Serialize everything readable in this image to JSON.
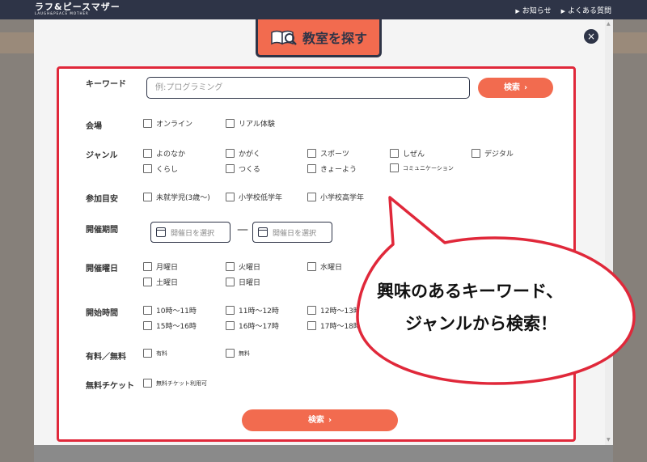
{
  "header": {
    "logo_main": "ラフ&ピースマザー",
    "logo_sub": "LAUGH&PEACE MOTHER",
    "links": [
      "お知らせ",
      "よくある質問"
    ]
  },
  "modal": {
    "title": "教室を探す",
    "close": "×"
  },
  "form": {
    "keyword_label": "キーワード",
    "keyword_placeholder": "例:プログラミング",
    "search_label": "検索",
    "chevron": "›",
    "venue_label": "会場",
    "venue_options": [
      "オンライン",
      "リアル体験"
    ],
    "genre_label": "ジャンル",
    "genre_options": [
      "よのなか",
      "かがく",
      "スポーツ",
      "しぜん",
      "デジタル",
      "くらし",
      "つくる",
      "きょーよう",
      "コミュニケーション"
    ],
    "age_label": "参加目安",
    "age_options": [
      "未就学児(3歳～)",
      "小学校低学年",
      "小学校高学年"
    ],
    "period_label": "開催期間",
    "date_placeholder": "開催日を選択",
    "date_separator": "—",
    "weekday_label": "開催曜日",
    "weekday_options": [
      "月曜日",
      "火曜日",
      "水曜日",
      "土曜日",
      "日曜日"
    ],
    "time_label": "開始時間",
    "time_options": [
      "10時～11時",
      "11時～12時",
      "12時～13時",
      "15時～16時",
      "16時～17時",
      "17時～18時"
    ],
    "fee_label": "有料／無料",
    "fee_options": [
      "有料",
      "無料"
    ],
    "ticket_label": "無料チケット",
    "ticket_options": [
      "無料チケット利用可"
    ],
    "bottom_search_label": "検索"
  },
  "callout": {
    "line1": "興味のあるキーワード、",
    "line2": "ジャンルから検索！"
  },
  "colors": {
    "accent": "#f26b4f",
    "navy": "#2e3447",
    "highlight_red": "#e0283a"
  }
}
